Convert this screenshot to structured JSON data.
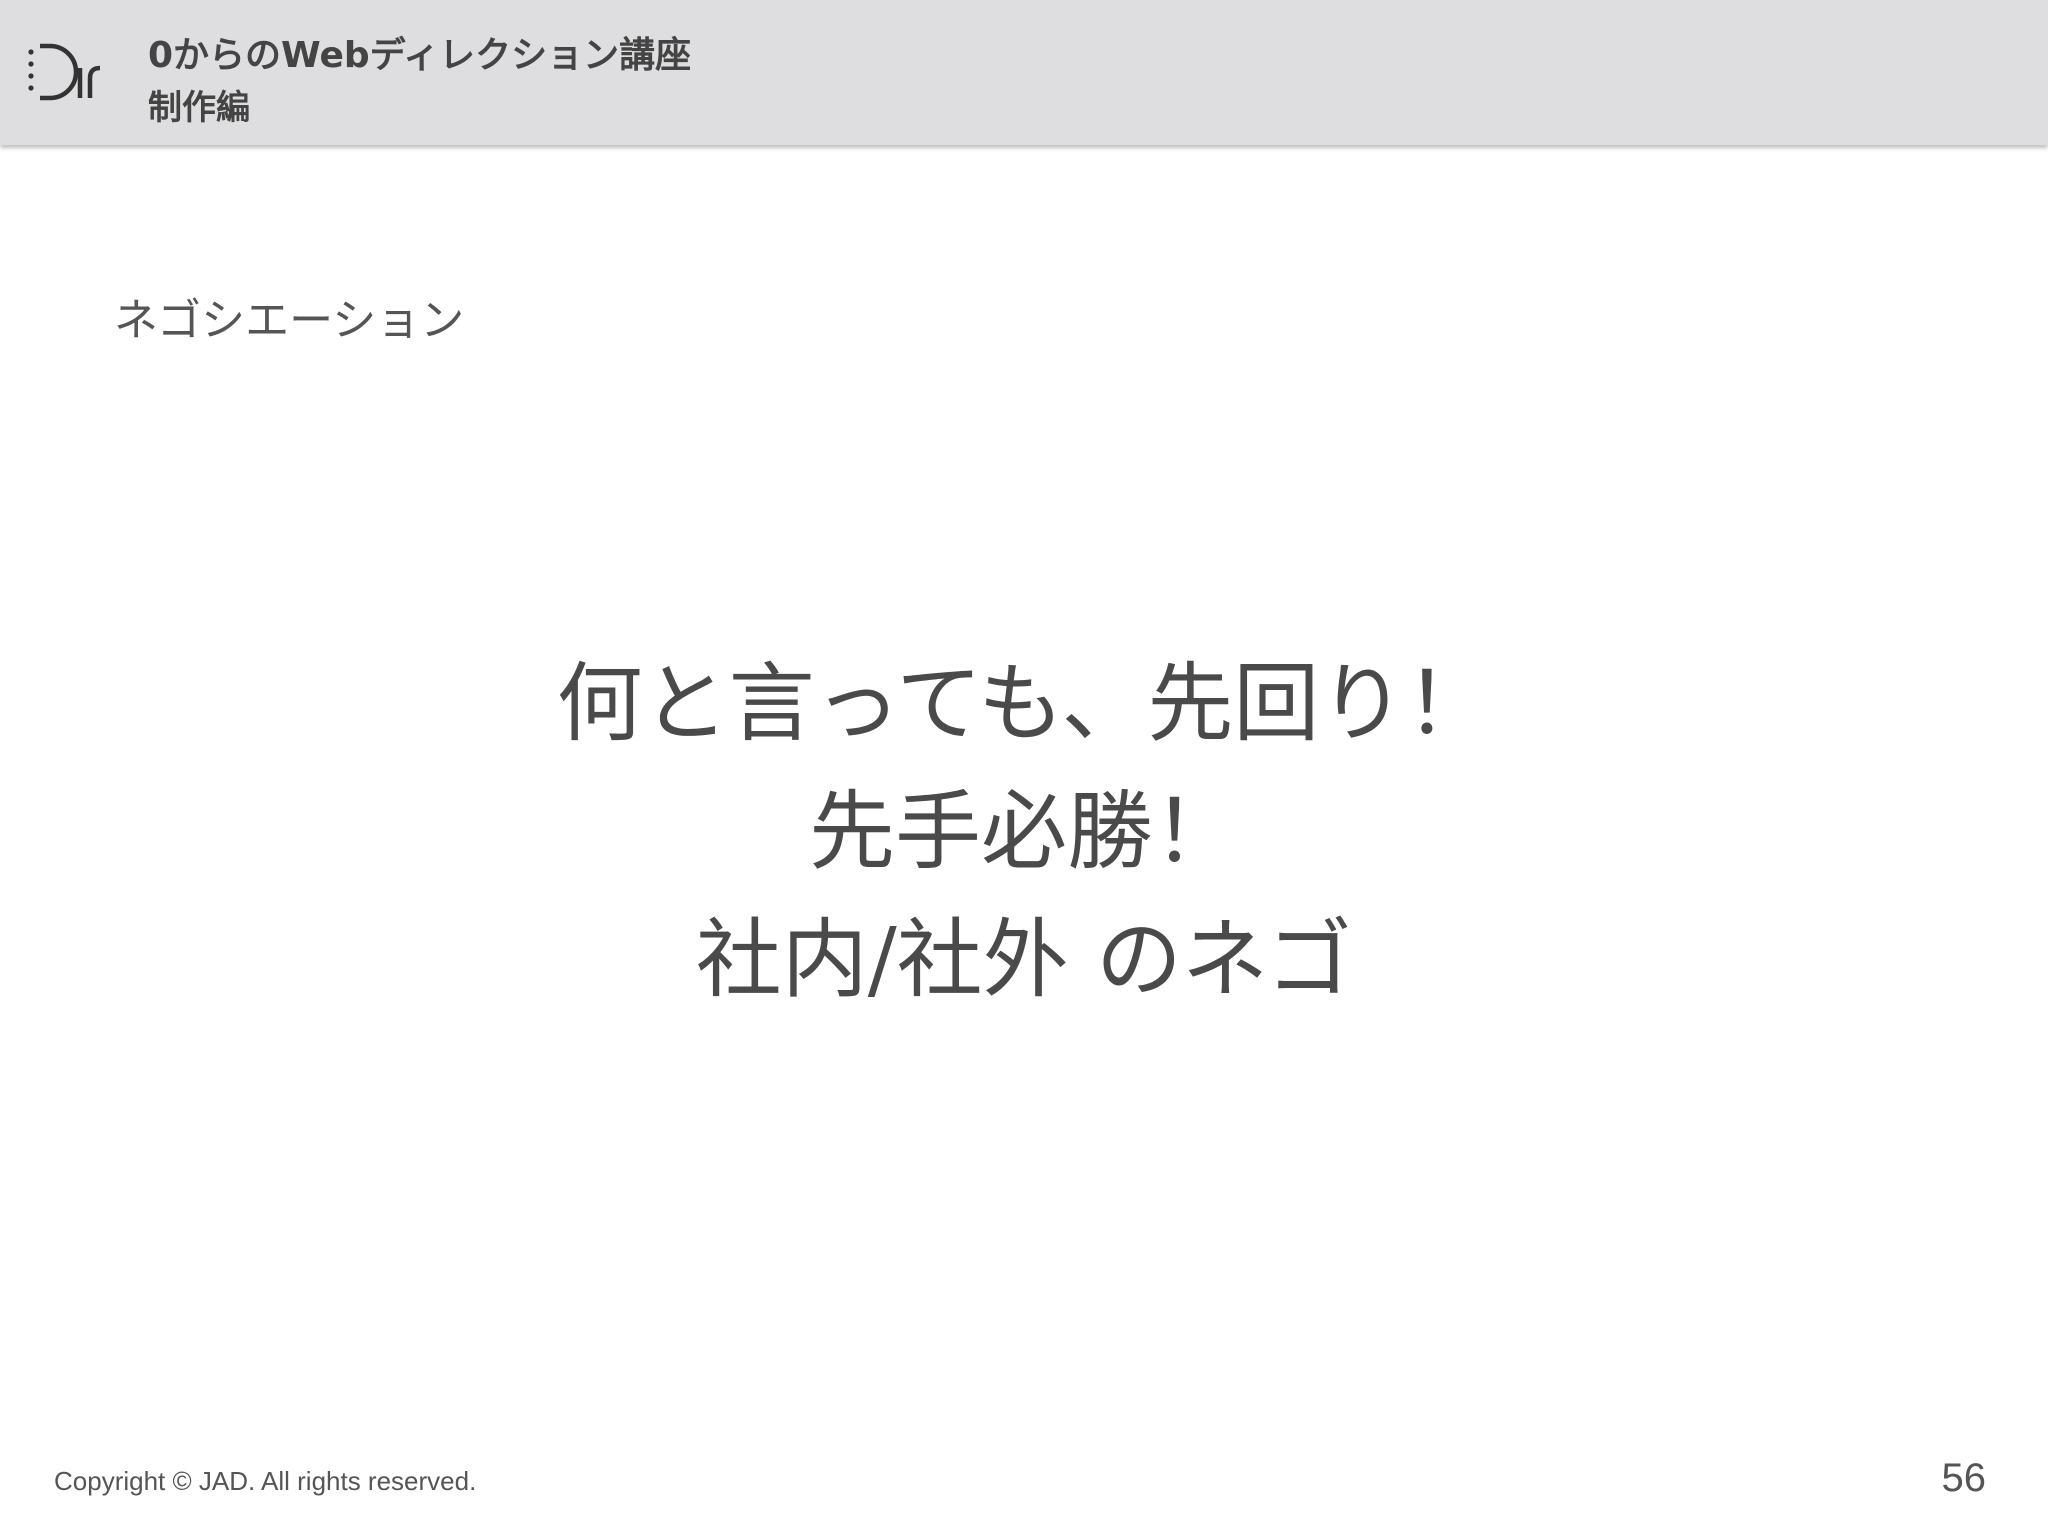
{
  "header": {
    "logo_icon": "dir-logo-icon",
    "title": "0からのWebディレクション講座",
    "subtitle": "制作編"
  },
  "section": {
    "heading": "ネゴシエーション"
  },
  "main": {
    "lines": [
      "何と言っても、先回り！",
      "先手必勝！",
      "社内/社外 のネゴ"
    ]
  },
  "footer": {
    "copyright": "Copyright © JAD. All rights reserved.",
    "page_number": "56"
  },
  "colors": {
    "header_bg": "#dedee0",
    "text": "#4a4a4a"
  }
}
